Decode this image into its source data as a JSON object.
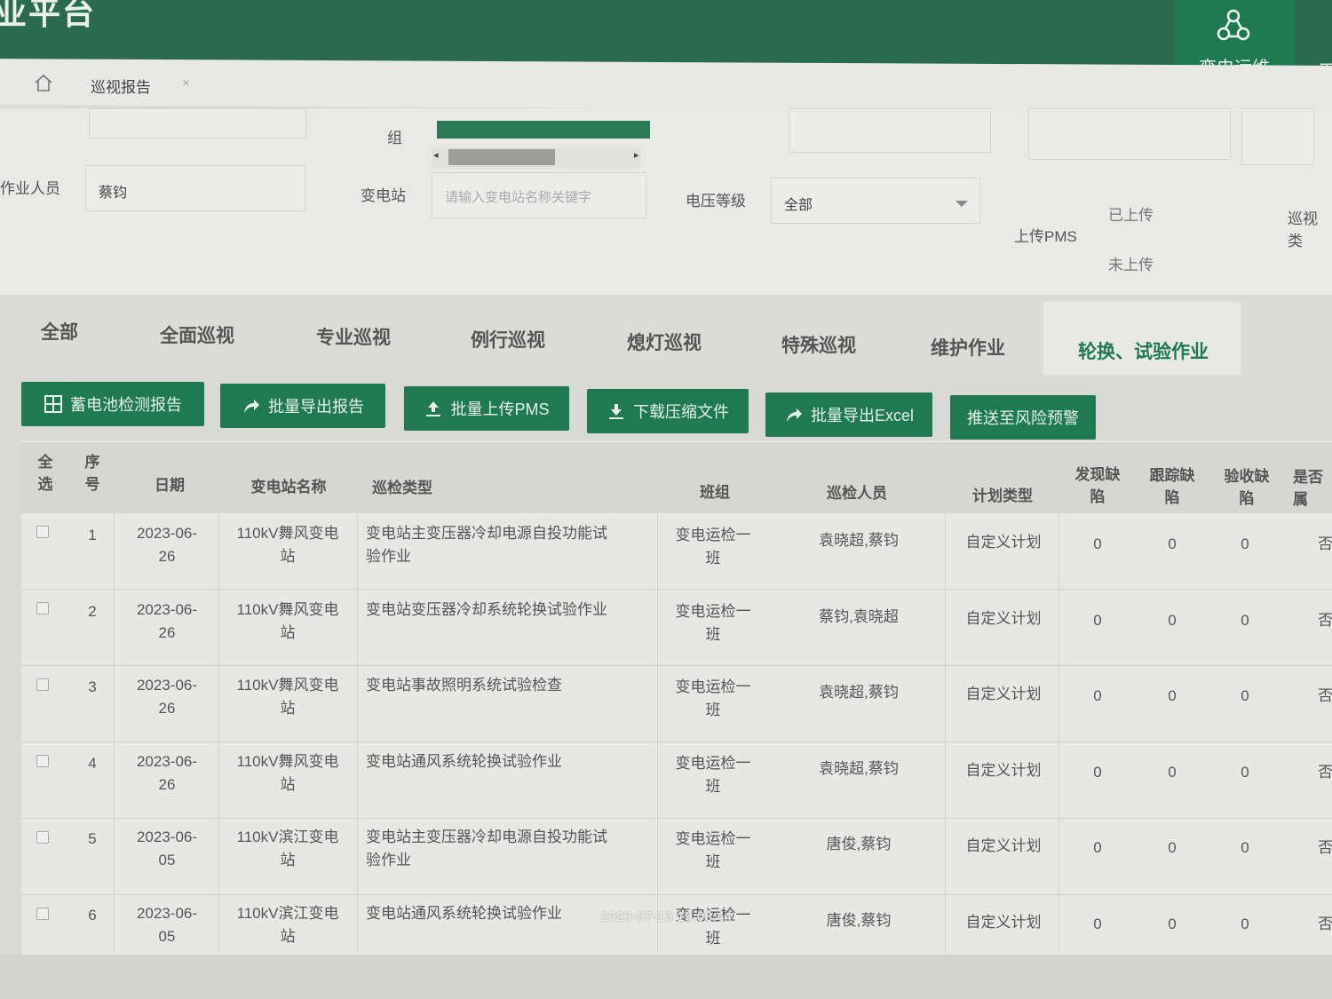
{
  "header": {
    "app_title": "业平台",
    "nav_active_label": "变电运维",
    "nav_next_label": "用"
  },
  "tabstrip": {
    "page_tab": "巡视报告",
    "close": "×"
  },
  "filters": {
    "group_label": "组",
    "operator_label": "作业人员",
    "operator_value": "蔡钧",
    "station_label": "变电站",
    "station_placeholder": "请输入变电站名称关键字",
    "voltage_label": "电压等级",
    "voltage_value": "全部",
    "pms_label": "上传PMS",
    "pms_uploaded": "已上传",
    "pms_not_uploaded": "未上传",
    "inspect_type_label": "巡视类"
  },
  "categories": [
    "全部",
    "全面巡视",
    "专业巡视",
    "例行巡视",
    "熄灯巡视",
    "特殊巡视",
    "维护作业",
    "轮换、试验作业"
  ],
  "buttons": [
    "蓄电池检测报告",
    "批量导出报告",
    "批量上传PMS",
    "下载压缩文件",
    "批量导出Excel",
    "推送至风险预警"
  ],
  "table": {
    "headers": {
      "select_all": [
        "全",
        "选"
      ],
      "index": [
        "序",
        "号"
      ],
      "date": "日期",
      "station": "变电站名称",
      "type": "巡检类型",
      "team": "班组",
      "people": "巡检人员",
      "plan": "计划类型",
      "found": [
        "发现缺",
        "陷"
      ],
      "tracked": [
        "跟踪缺",
        "陷"
      ],
      "accepted": [
        "验收缺",
        "陷"
      ],
      "is": [
        "是否",
        "属"
      ]
    },
    "rows": [
      {
        "no": "1",
        "date": [
          "2023-06-",
          "26"
        ],
        "station": [
          "110kV舞风变电",
          "站"
        ],
        "type": [
          "变电站主变压器冷却电源自投功能试",
          "验作业"
        ],
        "team": [
          "变电运检一",
          "班"
        ],
        "people": "袁晓超,蔡钧",
        "plan": "自定义计划",
        "found": "0",
        "tracked": "0",
        "accepted": "0",
        "flag": "否"
      },
      {
        "no": "2",
        "date": [
          "2023-06-",
          "26"
        ],
        "station": [
          "110kV舞风变电",
          "站"
        ],
        "type": [
          "变电站变压器冷却系统轮换试验作业",
          ""
        ],
        "team": [
          "变电运检一",
          "班"
        ],
        "people": "蔡钧,袁晓超",
        "plan": "自定义计划",
        "found": "0",
        "tracked": "0",
        "accepted": "0",
        "flag": "否"
      },
      {
        "no": "3",
        "date": [
          "2023-06-",
          "26"
        ],
        "station": [
          "110kV舞风变电",
          "站"
        ],
        "type": [
          "变电站事故照明系统试验检查",
          ""
        ],
        "team": [
          "变电运检一",
          "班"
        ],
        "people": "袁晓超,蔡钧",
        "plan": "自定义计划",
        "found": "0",
        "tracked": "0",
        "accepted": "0",
        "flag": "否"
      },
      {
        "no": "4",
        "date": [
          "2023-06-",
          "26"
        ],
        "station": [
          "110kV舞风变电",
          "站"
        ],
        "type": [
          "变电站通风系统轮换试验作业",
          ""
        ],
        "team": [
          "变电运检一",
          "班"
        ],
        "people": "袁晓超,蔡钧",
        "plan": "自定义计划",
        "found": "0",
        "tracked": "0",
        "accepted": "0",
        "flag": "否"
      },
      {
        "no": "5",
        "date": [
          "2023-06-",
          "05"
        ],
        "station": [
          "110kV滨江变电",
          "站"
        ],
        "type": [
          "变电站主变压器冷却电源自投功能试",
          "验作业"
        ],
        "team": [
          "变电运检一",
          "班"
        ],
        "people": "唐俊,蔡钧",
        "plan": "自定义计划",
        "found": "0",
        "tracked": "0",
        "accepted": "0",
        "flag": "否"
      },
      {
        "no": "6",
        "date": [
          "2023-06-",
          "05"
        ],
        "station": [
          "110kV滨江变电",
          "站"
        ],
        "type": [
          "变电站通风系统轮换试验作业",
          ""
        ],
        "team": [
          "变电运检一",
          "班"
        ],
        "people": "唐俊,蔡钧",
        "plan": "自定义计划",
        "found": "0",
        "tracked": "0",
        "accepted": "0",
        "flag": "否"
      }
    ]
  },
  "timestamp_overlay": "2023-07-13 19:08:44"
}
